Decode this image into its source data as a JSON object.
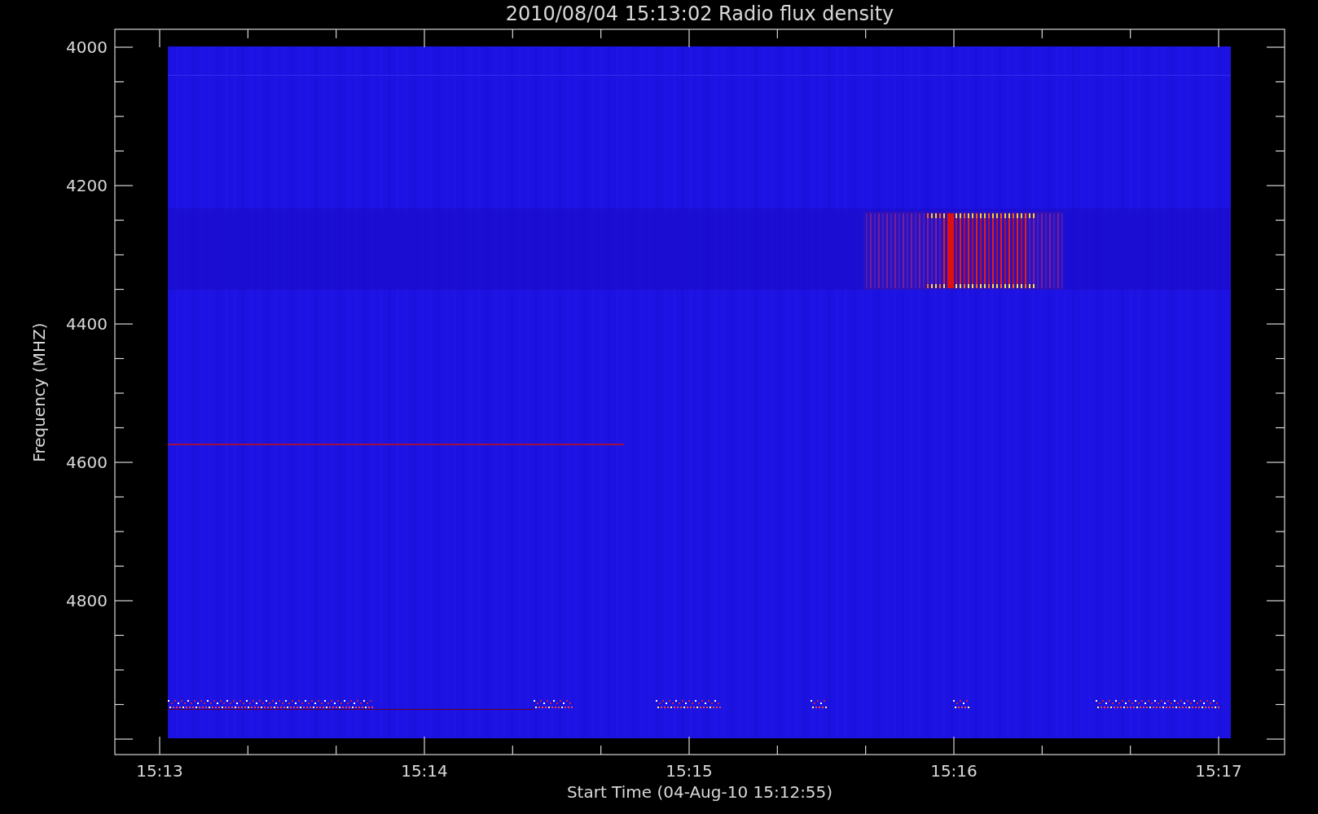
{
  "title": "2010/08/04 15:13:02 Radio flux density",
  "xlabel": "Start Time (04-Aug-10 15:12:55)",
  "ylabel": "Frequency (MHZ)",
  "xticks": [
    "15:13",
    "15:14",
    "15:15",
    "15:16",
    "15:17"
  ],
  "yticks": [
    "4000",
    "4200",
    "4400",
    "4600",
    "4800"
  ]
}
